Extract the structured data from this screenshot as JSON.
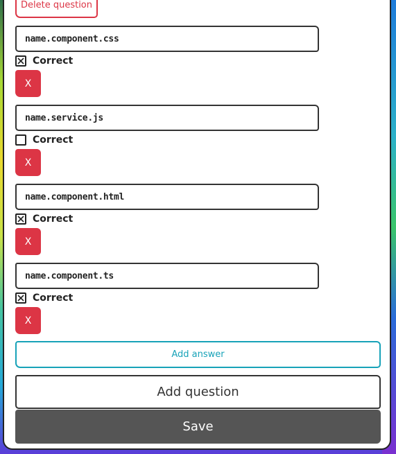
{
  "delete_question_label": "Delete question",
  "answers": [
    {
      "value": "name.component.css",
      "correct": true,
      "correct_label": "Correct",
      "remove_label": "X"
    },
    {
      "value": "name.service.js",
      "correct": false,
      "correct_label": "Correct",
      "remove_label": "X"
    },
    {
      "value": "name.component.html",
      "correct": true,
      "correct_label": "Correct",
      "remove_label": "X"
    },
    {
      "value": "name.component.ts",
      "correct": true,
      "correct_label": "Correct",
      "remove_label": "X"
    }
  ],
  "add_answer_label": "Add answer",
  "add_question_label": "Add question",
  "save_label": "Save",
  "colors": {
    "danger": "#dc3545",
    "info": "#17a2b8",
    "save_bg": "#555555"
  }
}
